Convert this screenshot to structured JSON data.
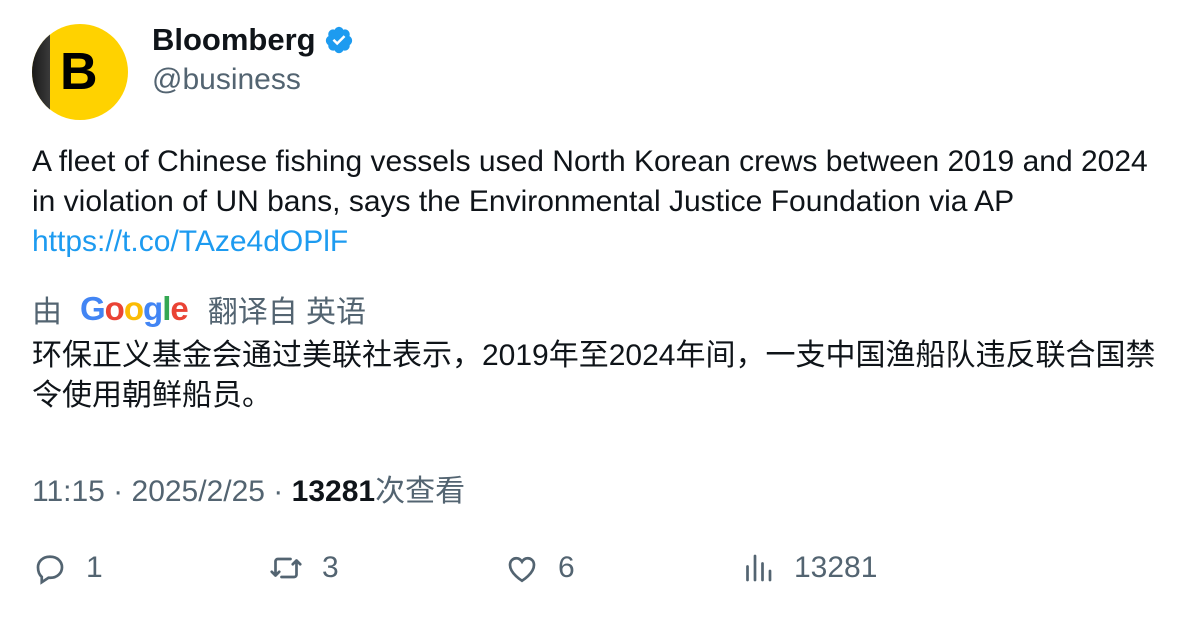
{
  "account": {
    "name": "Bloomberg",
    "handle": "@business",
    "avatar_letter": "B",
    "avatar_color": "#ffd200",
    "verified_color": "#1d9bf0"
  },
  "tweet": {
    "text": "A fleet of Chinese fishing vessels used North Korean crews between 2019 and 2024 in violation of UN bans, says the Environmental Justice Foundation via AP",
    "link": "https://t.co/TAze4dOPlF"
  },
  "translation": {
    "prefix": "由",
    "provider": "Google",
    "suffix": "翻译自 英语",
    "text": "环保正义基金会通过美联社表示，2019年至2024年间，一支中国渔船队违反联合国禁令使用朝鲜船员。"
  },
  "meta": {
    "time": "11:15 · 2025/2/25 · ",
    "views": "13281",
    "views_label": "次查看"
  },
  "actions": {
    "replies": "1",
    "retweets": "3",
    "likes": "6",
    "views": "13281"
  },
  "icons": [
    "reply-icon",
    "retweet-icon",
    "like-icon",
    "views-icon",
    "verified-icon"
  ]
}
